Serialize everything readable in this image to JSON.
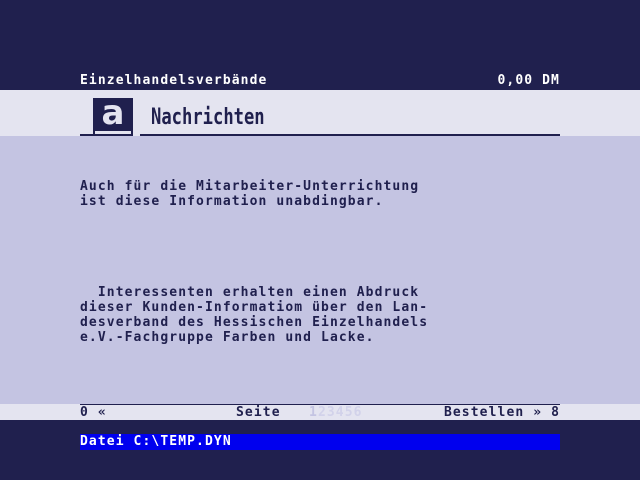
{
  "topline": {
    "left": "Einzelhandelsverbände",
    "right": "0,00 DM"
  },
  "header": {
    "logo_letter": "a",
    "title": "Nachrichten"
  },
  "content": {
    "paragraphs": [
      "Auch für die Mitarbeiter-Unterrichtung\nist diese Information unabdingbar.",
      "  Interessenten erhalten einen Abdruck\ndieser Kunden-Informatiom über den Lan-\ndesverband des Hessischen Einzelhandels\ne.V.-Fachgruppe Farben und Lacke."
    ]
  },
  "nav": {
    "prev": "0 «",
    "seite_label": "Seite",
    "current_page": "1",
    "other_pages": "23456",
    "next": "Bestellen » 8"
  },
  "filebar": {
    "label": "Datei C:\\TEMP.DYN"
  },
  "colors": {
    "background": "#20204e",
    "band": "#e4e4f0",
    "body": "#c4c4e2",
    "filebar": "#0000ee"
  }
}
